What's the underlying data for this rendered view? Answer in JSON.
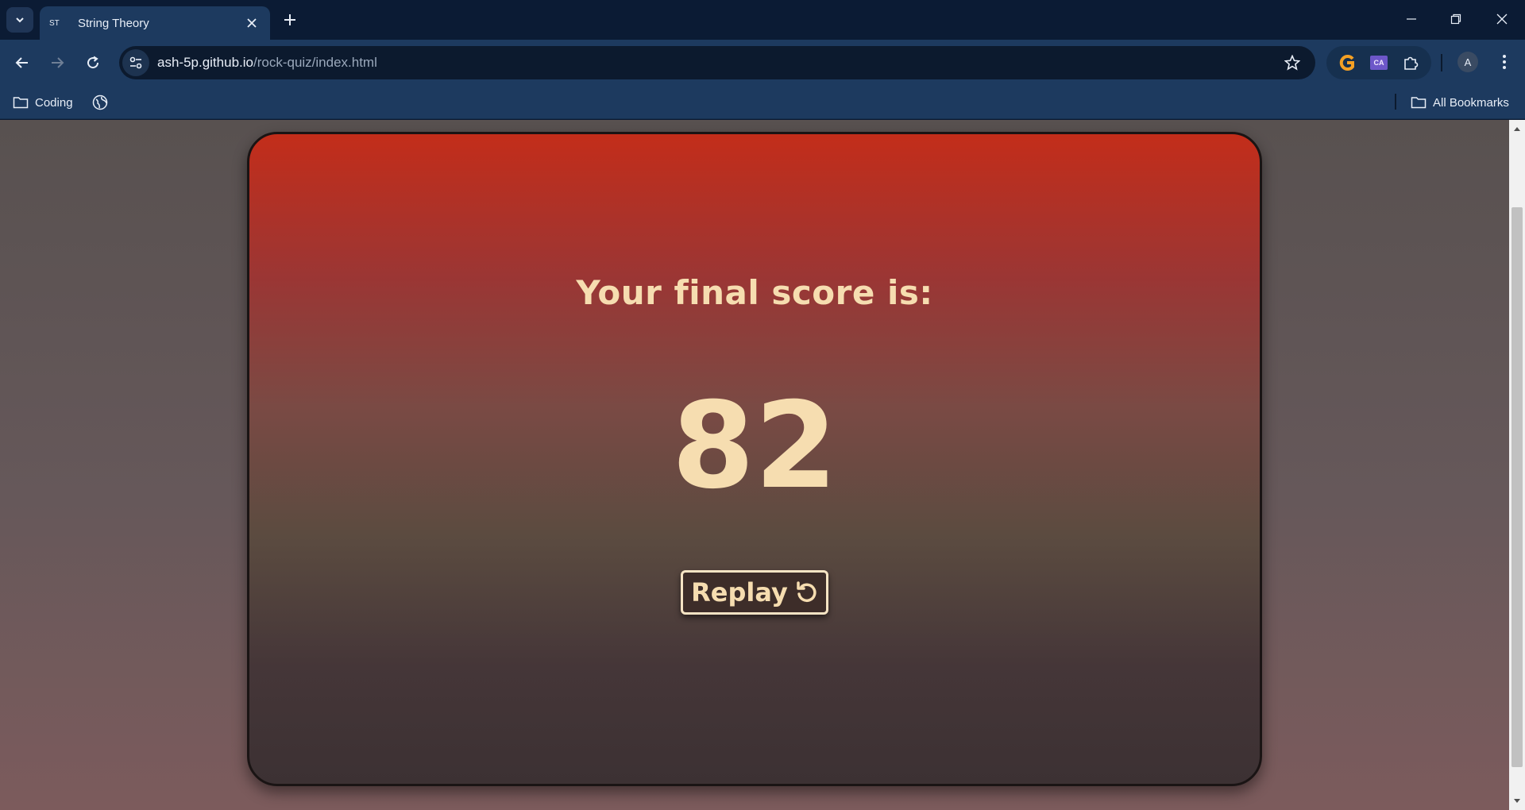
{
  "browser": {
    "tab": {
      "title": "String Theory",
      "favicon_text": "ST"
    },
    "url": {
      "host": "ash-5p.github.io",
      "path": "/rock-quiz/index.html"
    },
    "profile_initial": "A",
    "extensions": [
      {
        "name": "g-extension-icon"
      },
      {
        "name": "ca-extension-icon",
        "text": "CA"
      },
      {
        "name": "puzzle-icon"
      }
    ],
    "bookmarks": {
      "items": [
        {
          "label": "Coding",
          "icon": "folder-icon"
        },
        {
          "label": "",
          "icon": "globe-icon"
        }
      ],
      "all_bookmarks_label": "All Bookmarks"
    }
  },
  "page": {
    "score_title": "Your final score is:",
    "score_value": "82",
    "replay_label": "Replay",
    "colors": {
      "text": "#f6ddb0",
      "card_top": "#c32d1a",
      "card_bottom": "#3c3133",
      "button_border": "#f6e4c4"
    }
  }
}
